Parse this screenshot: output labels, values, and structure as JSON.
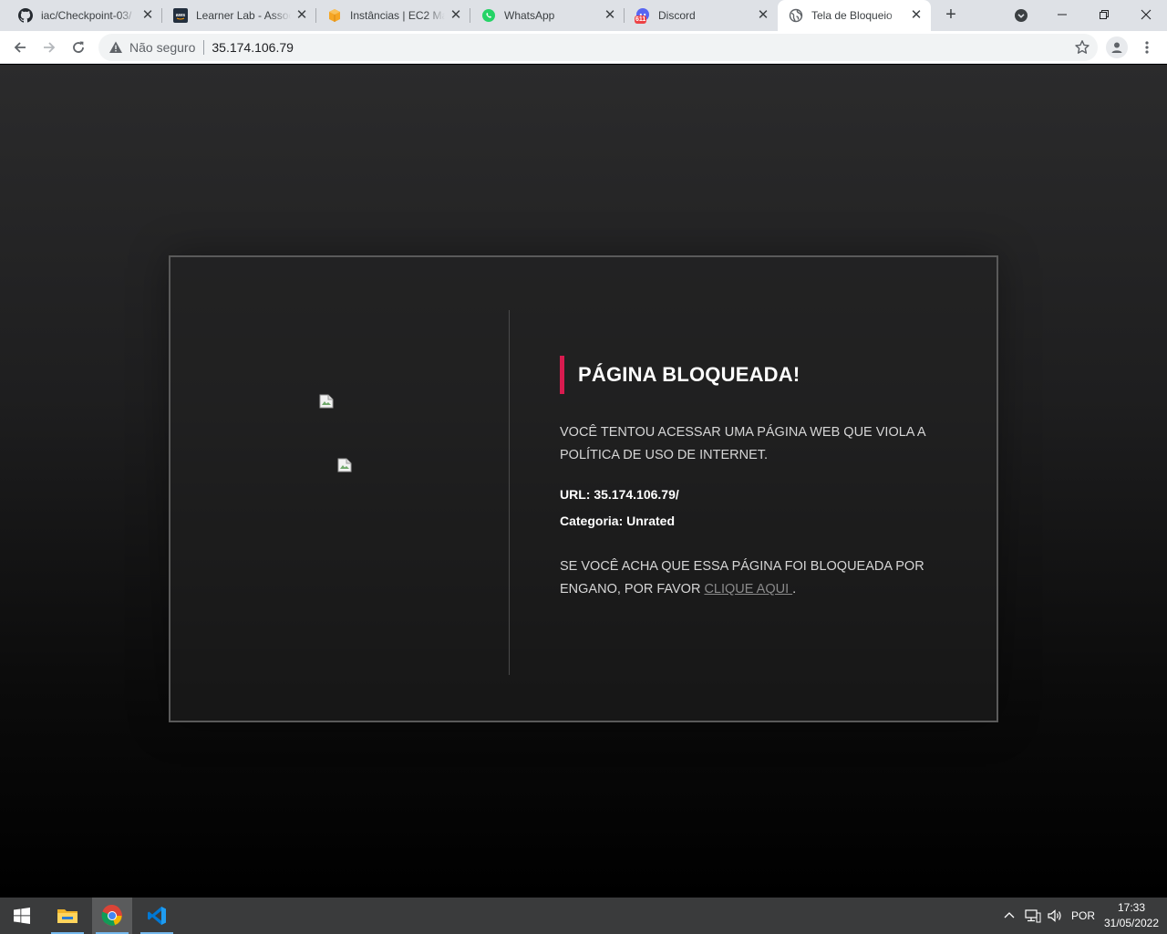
{
  "browser": {
    "tabs": [
      {
        "title": "iac/Checkpoint-03/",
        "icon": "github-icon"
      },
      {
        "title": "Learner Lab - Associ",
        "icon": "aws-icon"
      },
      {
        "title": "Instâncias | EC2 Man",
        "icon": "aws-ec2-icon"
      },
      {
        "title": "WhatsApp",
        "icon": "whatsapp-icon"
      },
      {
        "title": "Discord",
        "icon": "discord-icon",
        "badge": "611"
      },
      {
        "title": "Tela de Bloqueio",
        "icon": "globe-icon",
        "active": true
      }
    ],
    "security_label": "Não seguro",
    "url": "35.174.106.79"
  },
  "page": {
    "heading": "PÁGINA BLOQUEADA!",
    "message": "VOCÊ TENTOU ACESSAR UMA PÁGINA WEB QUE VIOLA A POLÍTICA DE USO DE INTERNET.",
    "url_line": "URL: 35.174.106.79/",
    "category_line": "Categoria: Unrated",
    "report_text": "SE VOCÊ ACHA QUE ESSA PÁGINA FOI BLOQUEADA POR ENGANO, POR FAVOR ",
    "report_link": "CLIQUE AQUI ",
    "report_end": ".",
    "accent_color": "#d81b4f"
  },
  "taskbar": {
    "apps": [
      "windows-start-icon",
      "file-explorer-icon",
      "chrome-icon",
      "vscode-icon"
    ],
    "language": "POR",
    "time": "17:33",
    "date": "31/05/2022"
  }
}
